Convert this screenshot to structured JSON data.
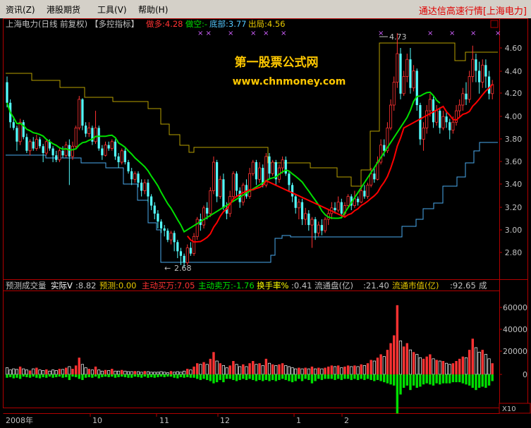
{
  "menu": {
    "items": [
      "资讯(Z)",
      "港股期货",
      "工具(V)",
      "帮助(H)"
    ],
    "title": "通达信高速行情[上海电力]"
  },
  "header": {
    "stock": "上海电力(日线 前复权)",
    "indicator": "【多控指标】",
    "long_label": "做多:4.28",
    "short_label": "做空:-",
    "bottom_label": "底部:3.77",
    "exit_label": "出局:4.56"
  },
  "watermark": {
    "line1": "第一股票公式网",
    "line2": "www.chnmoney.com"
  },
  "annotations": {
    "high": "4.73",
    "low": "2.68"
  },
  "price_axis": [
    "4.60",
    "4.40",
    "4.20",
    "4.00",
    "3.80",
    "3.60",
    "3.40",
    "3.20",
    "3.00",
    "2.80"
  ],
  "volume_header": {
    "title": "预测成交量",
    "actual_label": "实际V",
    "actual_value": ":8.82",
    "forecast": "预测:0.00",
    "buy": "主动买万:7.05",
    "sell": "主动卖万:-1.76",
    "turnover_label": "换手率%",
    "turnover_value": ":0.41",
    "float_shares_label": "流通盘(亿)",
    "float_shares_value": ":21.40",
    "market_value_label": "流通市值(亿)",
    "market_value_value": ":92.65",
    "tail": "成"
  },
  "volume_axis": [
    "60000",
    "40000",
    "20000",
    "0"
  ],
  "volume_unit": "X10",
  "time_axis": [
    "2008年",
    "10",
    "11",
    "12",
    "1",
    "2"
  ],
  "colors": {
    "up": "#ff3232",
    "down": "#54ffff",
    "ma_long": "#ff0000",
    "ma_green": "#00e000",
    "resistance": "#b8a000",
    "support": "#4aaaee",
    "axis": "#b00000",
    "menu_title": "#e00000"
  },
  "chart_data": {
    "type": "candlestick",
    "x_start_label": "2008年",
    "y_range": [
      2.68,
      4.73
    ],
    "candles": [
      [
        4.3,
        4.12,
        4.35,
        4.08
      ],
      [
        4.12,
        3.95,
        4.15,
        3.9
      ],
      [
        3.95,
        3.9,
        4.0,
        3.88
      ],
      [
        3.9,
        3.78,
        3.92,
        3.7
      ],
      [
        3.78,
        3.95,
        3.98,
        3.75
      ],
      [
        3.95,
        3.82,
        3.97,
        3.8
      ],
      [
        3.82,
        3.7,
        3.85,
        3.68
      ],
      [
        3.7,
        3.78,
        3.8,
        3.66
      ],
      [
        3.78,
        3.72,
        3.82,
        3.7
      ],
      [
        3.72,
        3.8,
        3.84,
        3.7
      ],
      [
        3.8,
        3.74,
        3.82,
        3.72
      ],
      [
        3.74,
        3.68,
        3.76,
        3.6
      ],
      [
        3.68,
        3.78,
        3.8,
        3.66
      ],
      [
        3.78,
        3.72,
        3.8,
        3.7
      ],
      [
        3.72,
        3.66,
        3.74,
        3.6
      ],
      [
        3.66,
        3.62,
        3.7,
        3.6
      ],
      [
        3.62,
        3.7,
        3.72,
        3.6
      ],
      [
        3.7,
        3.66,
        3.74,
        3.64
      ],
      [
        3.66,
        3.75,
        3.78,
        3.64
      ],
      [
        3.75,
        3.65,
        3.8,
        3.4
      ],
      [
        3.65,
        3.74,
        3.78,
        3.62
      ],
      [
        3.74,
        3.9,
        3.92,
        3.72
      ],
      [
        3.9,
        4.15,
        4.18,
        3.88
      ],
      [
        4.15,
        3.92,
        4.16,
        3.88
      ],
      [
        3.92,
        3.85,
        3.95,
        3.82
      ],
      [
        3.85,
        3.9,
        3.95,
        3.82
      ],
      [
        3.9,
        3.78,
        3.92,
        3.75
      ],
      [
        3.78,
        3.9,
        4.05,
        3.76
      ],
      [
        3.9,
        3.72,
        3.92,
        3.7
      ],
      [
        3.72,
        3.66,
        3.75,
        3.62
      ],
      [
        3.66,
        3.75,
        3.78,
        3.65
      ],
      [
        3.75,
        3.72,
        3.78,
        3.7
      ],
      [
        3.72,
        3.78,
        3.8,
        3.7
      ],
      [
        3.78,
        3.65,
        3.8,
        3.62
      ],
      [
        3.65,
        3.6,
        3.68,
        3.55
      ],
      [
        3.6,
        3.7,
        3.72,
        3.58
      ],
      [
        3.7,
        3.6,
        3.72,
        3.58
      ],
      [
        3.6,
        3.52,
        3.62,
        3.5
      ],
      [
        3.52,
        3.45,
        3.55,
        3.4
      ],
      [
        3.45,
        3.5,
        3.52,
        3.42
      ],
      [
        3.5,
        3.42,
        3.52,
        3.38
      ],
      [
        3.42,
        3.35,
        3.45,
        3.3
      ],
      [
        3.35,
        3.42,
        3.45,
        3.32
      ],
      [
        3.42,
        3.3,
        3.45,
        3.25
      ],
      [
        3.3,
        3.22,
        3.32,
        3.18
      ],
      [
        3.22,
        3.15,
        3.25,
        3.1
      ],
      [
        3.15,
        3.08,
        3.18,
        3.02
      ],
      [
        3.08,
        3.02,
        3.1,
        2.98
      ],
      [
        3.02,
        3.0,
        3.05,
        2.95
      ],
      [
        3.0,
        2.92,
        3.02,
        2.9
      ],
      [
        2.92,
        2.98,
        3.0,
        2.88
      ],
      [
        2.98,
        2.9,
        3.0,
        2.82
      ],
      [
        2.9,
        2.82,
        2.92,
        2.76
      ],
      [
        2.82,
        2.78,
        2.85,
        2.7
      ],
      [
        2.78,
        2.72,
        2.8,
        2.68
      ],
      [
        2.72,
        2.85,
        2.88,
        2.7
      ],
      [
        2.85,
        2.8,
        2.9,
        2.78
      ],
      [
        2.8,
        2.95,
        2.98,
        2.78
      ],
      [
        2.95,
        3.1,
        3.12,
        2.92
      ],
      [
        3.1,
        3.05,
        3.15,
        3.0
      ],
      [
        3.05,
        3.2,
        3.22,
        3.02
      ],
      [
        3.2,
        3.15,
        3.25,
        3.1
      ],
      [
        3.15,
        3.35,
        3.38,
        3.12
      ],
      [
        3.35,
        3.6,
        3.65,
        3.32
      ],
      [
        3.6,
        3.3,
        3.62,
        3.25
      ],
      [
        3.3,
        3.45,
        3.48,
        3.28
      ],
      [
        3.45,
        3.2,
        3.5,
        3.18
      ],
      [
        3.2,
        3.15,
        3.25,
        3.1
      ],
      [
        3.15,
        3.3,
        3.35,
        3.12
      ],
      [
        3.3,
        3.5,
        3.52,
        3.28
      ],
      [
        3.5,
        3.35,
        3.52,
        3.3
      ],
      [
        3.35,
        3.25,
        3.38,
        3.2
      ],
      [
        3.25,
        3.4,
        3.42,
        3.22
      ],
      [
        3.4,
        3.3,
        3.45,
        3.28
      ],
      [
        3.3,
        3.5,
        3.55,
        3.28
      ],
      [
        3.5,
        3.6,
        3.62,
        3.48
      ],
      [
        3.6,
        3.45,
        3.62,
        3.4
      ],
      [
        3.45,
        3.55,
        3.6,
        3.42
      ],
      [
        3.55,
        3.4,
        3.58,
        3.38
      ],
      [
        3.4,
        3.65,
        3.68,
        3.38
      ],
      [
        3.65,
        3.5,
        3.68,
        3.45
      ],
      [
        3.5,
        3.6,
        3.62,
        3.48
      ],
      [
        3.6,
        3.45,
        3.62,
        3.4
      ],
      [
        3.45,
        3.55,
        3.58,
        3.42
      ],
      [
        3.55,
        3.62,
        3.65,
        3.5
      ],
      [
        3.62,
        3.5,
        3.65,
        3.48
      ],
      [
        3.5,
        3.4,
        3.52,
        3.35
      ],
      [
        3.4,
        3.3,
        3.42,
        3.25
      ],
      [
        3.3,
        3.2,
        3.32,
        3.15
      ],
      [
        3.2,
        3.25,
        3.28,
        3.1
      ],
      [
        3.25,
        3.1,
        3.28,
        3.05
      ],
      [
        3.1,
        3.15,
        3.2,
        3.05
      ],
      [
        3.15,
        3.05,
        3.18,
        3.0
      ],
      [
        3.05,
        3.1,
        3.12,
        2.85
      ],
      [
        3.1,
        2.98,
        3.12,
        2.92
      ],
      [
        2.98,
        3.05,
        3.08,
        2.95
      ],
      [
        3.05,
        3.0,
        3.1,
        2.96
      ],
      [
        3.0,
        3.1,
        3.12,
        2.98
      ],
      [
        3.1,
        3.15,
        3.18,
        3.05
      ],
      [
        3.15,
        3.2,
        3.25,
        3.1
      ],
      [
        3.2,
        3.18,
        3.25,
        3.15
      ],
      [
        3.18,
        3.25,
        3.3,
        3.16
      ],
      [
        3.25,
        3.15,
        3.28,
        3.12
      ],
      [
        3.15,
        3.22,
        3.25,
        3.12
      ],
      [
        3.22,
        3.3,
        3.32,
        3.2
      ],
      [
        3.3,
        3.22,
        3.32,
        3.18
      ],
      [
        3.22,
        3.28,
        3.35,
        3.2
      ],
      [
        3.28,
        3.25,
        3.3,
        3.22
      ],
      [
        3.25,
        3.35,
        3.4,
        3.24
      ],
      [
        3.35,
        3.3,
        3.4,
        3.28
      ],
      [
        3.3,
        3.4,
        3.42,
        3.28
      ],
      [
        3.4,
        3.5,
        3.55,
        3.38
      ],
      [
        3.5,
        3.45,
        3.55,
        3.42
      ],
      [
        3.45,
        3.6,
        3.65,
        3.44
      ],
      [
        3.6,
        3.75,
        3.8,
        3.58
      ],
      [
        3.75,
        3.7,
        3.8,
        3.65
      ],
      [
        3.7,
        3.9,
        3.95,
        3.68
      ],
      [
        3.9,
        4.1,
        4.15,
        3.88
      ],
      [
        4.1,
        4.3,
        4.35,
        4.05
      ],
      [
        4.3,
        4.55,
        4.73,
        4.25
      ],
      [
        4.55,
        4.2,
        4.6,
        4.15
      ],
      [
        4.2,
        4.35,
        4.4,
        4.18
      ],
      [
        4.35,
        4.5,
        4.55,
        4.3
      ],
      [
        4.5,
        4.25,
        4.6,
        4.2
      ],
      [
        4.25,
        4.4,
        4.45,
        4.22
      ],
      [
        4.4,
        4.1,
        4.42,
        4.05
      ],
      [
        4.1,
        3.8,
        4.12,
        3.75
      ],
      [
        3.8,
        3.9,
        3.95,
        3.7
      ],
      [
        3.9,
        4.05,
        4.1,
        3.85
      ],
      [
        4.05,
        4.15,
        4.2,
        4.0
      ],
      [
        4.15,
        3.95,
        4.18,
        3.9
      ],
      [
        3.95,
        4.05,
        4.1,
        3.92
      ],
      [
        4.05,
        3.9,
        4.08,
        3.85
      ],
      [
        3.9,
        4.0,
        4.05,
        3.88
      ],
      [
        4.0,
        3.95,
        4.05,
        3.9
      ],
      [
        3.95,
        3.88,
        3.98,
        3.8
      ],
      [
        3.88,
        3.95,
        4.0,
        3.85
      ],
      [
        3.95,
        4.05,
        4.1,
        3.92
      ],
      [
        4.05,
        4.1,
        4.15,
        4.0
      ],
      [
        4.1,
        4.2,
        4.25,
        4.05
      ],
      [
        4.2,
        4.15,
        4.3,
        4.1
      ],
      [
        4.15,
        4.35,
        4.4,
        4.12
      ],
      [
        4.35,
        4.5,
        4.62,
        4.3
      ],
      [
        4.5,
        4.4,
        4.55,
        4.3
      ],
      [
        4.4,
        4.3,
        4.48,
        4.2
      ],
      [
        4.3,
        4.45,
        4.5,
        4.25
      ],
      [
        4.45,
        4.35,
        4.5,
        4.25
      ],
      [
        4.35,
        4.2,
        4.4,
        4.15
      ],
      [
        4.2,
        4.28,
        4.32,
        4.15
      ]
    ],
    "volumes": [
      [
        6000,
        -3000
      ],
      [
        4000,
        -2500
      ],
      [
        5000,
        -3500
      ],
      [
        4500,
        -3000
      ],
      [
        7000,
        -4000
      ],
      [
        5000,
        -2000
      ],
      [
        4000,
        -2500
      ],
      [
        3500,
        -3000
      ],
      [
        5000,
        -2000
      ],
      [
        6000,
        -3000
      ],
      [
        4000,
        -3500
      ],
      [
        3500,
        -2500
      ],
      [
        4500,
        -3000
      ],
      [
        3000,
        -2000
      ],
      [
        4000,
        -3000
      ],
      [
        3500,
        -2500
      ],
      [
        5000,
        -2000
      ],
      [
        4500,
        -3000
      ],
      [
        6000,
        -2500
      ],
      [
        7000,
        -5000
      ],
      [
        5000,
        -2000
      ],
      [
        8000,
        -2500
      ],
      [
        15000,
        -4000
      ],
      [
        9000,
        -5000
      ],
      [
        6000,
        -3000
      ],
      [
        5000,
        -2500
      ],
      [
        4000,
        -3000
      ],
      [
        7000,
        -2000
      ],
      [
        4000,
        -3500
      ],
      [
        3000,
        -2500
      ],
      [
        4000,
        -2000
      ],
      [
        3500,
        -2500
      ],
      [
        5000,
        -2000
      ],
      [
        3000,
        -3000
      ],
      [
        3000,
        -2500
      ],
      [
        4000,
        -2000
      ],
      [
        3000,
        -2500
      ],
      [
        2500,
        -3000
      ],
      [
        2500,
        -3000
      ],
      [
        3000,
        -2000
      ],
      [
        2500,
        -2500
      ],
      [
        2000,
        -3000
      ],
      [
        3000,
        -2000
      ],
      [
        2500,
        -3000
      ],
      [
        2000,
        -2500
      ],
      [
        2000,
        -3000
      ],
      [
        2000,
        -2500
      ],
      [
        2500,
        -2000
      ],
      [
        2000,
        -2500
      ],
      [
        1500,
        -2000
      ],
      [
        3000,
        -2000
      ],
      [
        2000,
        -3000
      ],
      [
        2500,
        -3500
      ],
      [
        2000,
        -2500
      ],
      [
        3000,
        -3000
      ],
      [
        5000,
        -2500
      ],
      [
        4000,
        -3000
      ],
      [
        7000,
        -3000
      ],
      [
        10000,
        -4000
      ],
      [
        9000,
        -5000
      ],
      [
        11000,
        -4000
      ],
      [
        9000,
        -5000
      ],
      [
        14000,
        -6000
      ],
      [
        20000,
        -8000
      ],
      [
        12000,
        -7000
      ],
      [
        10000,
        -5000
      ],
      [
        8000,
        -7000
      ],
      [
        6000,
        -4000
      ],
      [
        8000,
        -4000
      ],
      [
        12000,
        -5000
      ],
      [
        9000,
        -6000
      ],
      [
        7000,
        -5000
      ],
      [
        9000,
        -4000
      ],
      [
        7000,
        -5000
      ],
      [
        10000,
        -4000
      ],
      [
        12000,
        -5000
      ],
      [
        9000,
        -6000
      ],
      [
        10000,
        -5000
      ],
      [
        8000,
        -6000
      ],
      [
        14000,
        -5000
      ],
      [
        10000,
        -6000
      ],
      [
        9000,
        -5000
      ],
      [
        8000,
        -6000
      ],
      [
        9000,
        -5000
      ],
      [
        10000,
        -4000
      ],
      [
        8000,
        -5000
      ],
      [
        7000,
        -6000
      ],
      [
        6000,
        -7000
      ],
      [
        5000,
        -6000
      ],
      [
        6000,
        -4000
      ],
      [
        5000,
        -6000
      ],
      [
        6000,
        -4000
      ],
      [
        5000,
        -5000
      ],
      [
        7000,
        -8000
      ],
      [
        5000,
        -6000
      ],
      [
        6000,
        -4000
      ],
      [
        5000,
        -5000
      ],
      [
        6000,
        -4000
      ],
      [
        7000,
        -4000
      ],
      [
        8000,
        -4000
      ],
      [
        7000,
        -5000
      ],
      [
        8000,
        -4000
      ],
      [
        6000,
        -5000
      ],
      [
        7000,
        -4000
      ],
      [
        8000,
        -4000
      ],
      [
        7000,
        -5000
      ],
      [
        8000,
        -4000
      ],
      [
        7000,
        -5000
      ],
      [
        9000,
        -4000
      ],
      [
        8000,
        -5000
      ],
      [
        10000,
        -4000
      ],
      [
        13000,
        -5000
      ],
      [
        12000,
        -6000
      ],
      [
        15000,
        -5000
      ],
      [
        18000,
        -6000
      ],
      [
        16000,
        -7000
      ],
      [
        22000,
        -8000
      ],
      [
        28000,
        -9000
      ],
      [
        35000,
        -10000
      ],
      [
        62000,
        -35000
      ],
      [
        30000,
        -18000
      ],
      [
        25000,
        -12000
      ],
      [
        28000,
        -10000
      ],
      [
        22000,
        -14000
      ],
      [
        20000,
        -10000
      ],
      [
        18000,
        -12000
      ],
      [
        15000,
        -11000
      ],
      [
        14000,
        -9000
      ],
      [
        16000,
        -8000
      ],
      [
        18000,
        -9000
      ],
      [
        14000,
        -10000
      ],
      [
        13000,
        -8000
      ],
      [
        12000,
        -9000
      ],
      [
        12000,
        -8000
      ],
      [
        10000,
        -8000
      ],
      [
        9000,
        -8000
      ],
      [
        10000,
        -7000
      ],
      [
        12000,
        -7000
      ],
      [
        14000,
        -7000
      ],
      [
        16000,
        -8000
      ],
      [
        15000,
        -9000
      ],
      [
        22000,
        -10000
      ],
      [
        32000,
        -12000
      ],
      [
        24000,
        -14000
      ],
      [
        20000,
        -12000
      ],
      [
        22000,
        -11000
      ],
      [
        18000,
        -12000
      ],
      [
        14000,
        -10000
      ],
      [
        10000,
        -6000
      ]
    ]
  }
}
